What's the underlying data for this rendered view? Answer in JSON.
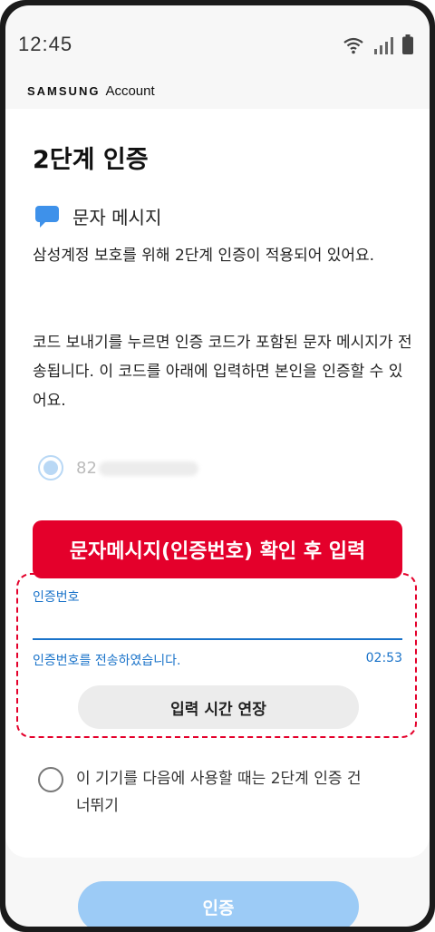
{
  "status_bar": {
    "time": "12:45"
  },
  "brand": {
    "samsung": "SAMSUNG",
    "account": "Account"
  },
  "page": {
    "title": "2단계 인증",
    "method_label": "문자 메시지",
    "description_1": "삼성계정 보호를 위해 2단계 인증이 적용되어 있어요.",
    "description_2": "코드 보내기를 누르면 인증 코드가 포함된 문자 메시지가 전송됩니다. 이 코드를 아래에 입력하면 본인을 인증할 수 있어요.",
    "phone_prefix": "82"
  },
  "callout": {
    "text": "문자메시지(인증번호) 확인 후 입력"
  },
  "code_field": {
    "label": "인증번호",
    "value": "",
    "hint": "인증번호를 전송하였습니다.",
    "timer": "02:53"
  },
  "buttons": {
    "extend_label": "입력 시간 연장",
    "verify_label": "인증"
  },
  "skip_option": {
    "label": "이 기기를 다음에 사용할 때는 2단계 인증 건너뛰기"
  },
  "colors": {
    "accent": "#1a73c9",
    "callout": "#e4002b",
    "verify_disabled": "#9ccbf6"
  }
}
